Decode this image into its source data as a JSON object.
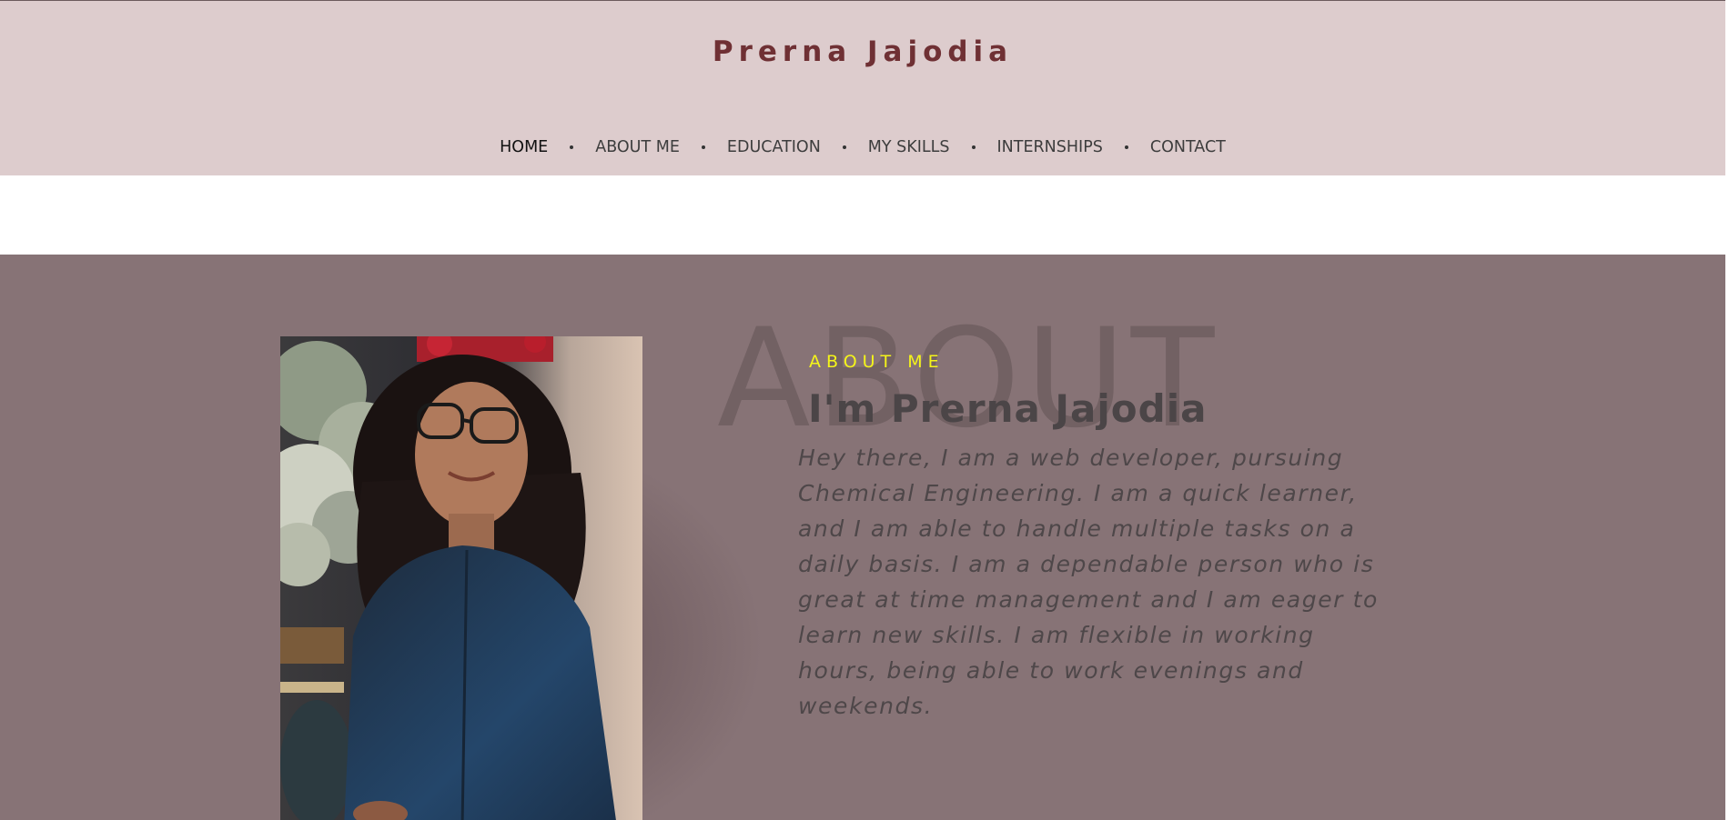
{
  "header": {
    "brand": "Prerna Jajodia",
    "nav": [
      {
        "label": "HOME",
        "active": true
      },
      {
        "label": "ABOUT ME"
      },
      {
        "label": "EDUCATION"
      },
      {
        "label": "MY SKILLS"
      },
      {
        "label": "INTERNSHIPS"
      },
      {
        "label": "CONTACT"
      }
    ]
  },
  "about": {
    "watermark": "ABOUT",
    "eyebrow": "ABOUT ME",
    "heading": "I'm Prerna Jajodia",
    "bio": "Hey there, I am a web developer, pursuing Chemical Engineering. I am a quick learner, and I am able to handle multiple tasks on a daily basis. I am a dependable person who is great at time management and I am eager to learn new skills. I am flexible in working hours, being able to work evenings and weekends."
  },
  "colors": {
    "header_bg": "#ddcccd",
    "brand": "#6f3034",
    "section_bg": "#877376",
    "eyebrow": "#f4f41a"
  }
}
